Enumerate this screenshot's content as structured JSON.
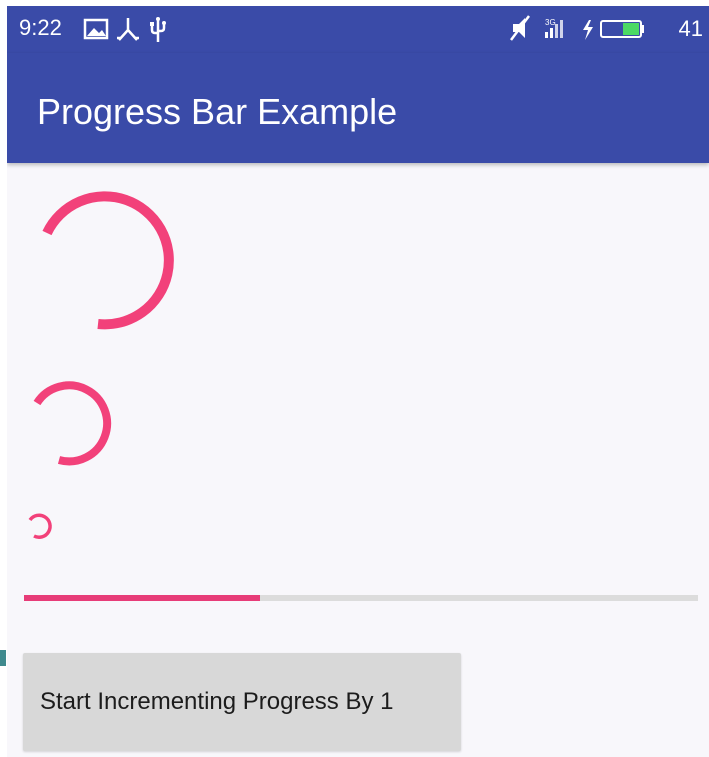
{
  "status_bar": {
    "time": "9:22",
    "left_icons": [
      "image-icon",
      "usb-debug-icon",
      "usb-icon"
    ],
    "right_icons": [
      "mute-icon",
      "signal-icon",
      "charging-icon",
      "battery-icon"
    ],
    "battery_percent": "41"
  },
  "app_bar": {
    "title": "Progress Bar Example"
  },
  "spinners": [
    {
      "name": "large-spinner",
      "color": "#f2417a"
    },
    {
      "name": "medium-spinner",
      "color": "#f2417a"
    },
    {
      "name": "small-spinner",
      "color": "#f2417a"
    }
  ],
  "linear_progress": {
    "value_fraction": 0.35,
    "color": "#e73c78",
    "track_color": "#dcdcdc"
  },
  "button": {
    "label": "Start Incrementing Progress By 1"
  },
  "colors": {
    "primary": "#3a4ba8",
    "accent": "#f2417a",
    "background": "#f8f7fb"
  }
}
